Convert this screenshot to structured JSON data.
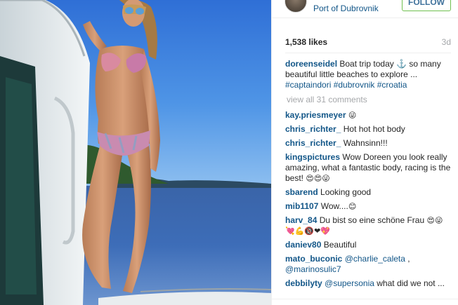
{
  "post": {
    "location": "Port of Dubrovnik",
    "follow_label": "FOLLOW",
    "likes": "1,538 likes",
    "age": "3d"
  },
  "caption": {
    "user": "doreenseidel",
    "text": "Boat trip today ⚓ so many beautiful little beaches to explore ...",
    "tags": "#captaindori #dubrovnik #croatia"
  },
  "view_all_label": "view all 31 comments",
  "comments": [
    {
      "user": "kay.priesmeyer",
      "text": "",
      "emoji": "😜"
    },
    {
      "user": "chris_richter_",
      "text": "Hot hot hot body",
      "emoji": ""
    },
    {
      "user": "chris_richter_",
      "text": "Wahnsinn!!!",
      "emoji": ""
    },
    {
      "user": "kingspictures",
      "text": "Wow Doreen you look really amazing, what a fantastic body, racing is the best!",
      "emoji": "😍😍😜"
    },
    {
      "user": "sbarend",
      "text": "Looking good",
      "emoji": ""
    },
    {
      "user": "mib1107",
      "text": "Wow....",
      "emoji": "😊"
    },
    {
      "user": "harv_84",
      "text": "Du bist so eine schöne Frau",
      "emoji": "😍😜💘💪🔞❤💖"
    },
    {
      "user": "daniev80",
      "text": "Beautiful",
      "emoji": ""
    },
    {
      "user": "mato_buconic",
      "mention1": "@charlie_caleta",
      "mid": " ,",
      "mention2": "@marinosulic7"
    },
    {
      "user": "debbilyty",
      "mention1": "@supersonia",
      "text": " what did we not ..."
    }
  ],
  "colors": {
    "username": "#125688",
    "follow_border": "#70c050",
    "follow_text": "#3f729b",
    "muted": "#a5a7aa"
  },
  "icons": [
    "anchor-icon"
  ]
}
